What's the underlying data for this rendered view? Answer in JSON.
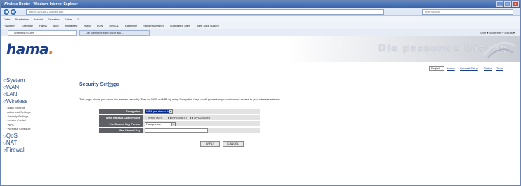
{
  "window": {
    "title": "Wireless Router - Windows Internet Explorer",
    "controls": [
      "_",
      "□",
      "x"
    ]
  },
  "address": {
    "url": "http://192.168.2.1/index.asp",
    "search_placeholder": "Live Search"
  },
  "menubar": {
    "items": [
      "Datei",
      "Bearbeiten",
      "Ansicht",
      "Favoriten",
      "Extras",
      "?"
    ]
  },
  "favorites": {
    "items": [
      "Favoriten",
      "EasyNav",
      "Hama",
      "Audi",
      "Raiffeisen",
      "Hypo",
      "FON",
      "MySQL",
      "Kategorie",
      "Stellenanzeigen",
      "Suggested Sites",
      "Web Slice Gallery"
    ]
  },
  "tabs": {
    "items": [
      "Wireless Router",
      "Die Webseite kann nicht ang..."
    ],
    "commands": "Seite ▾  Sicherheit ▾  Extras ▾"
  },
  "brand": {
    "logo": "hama",
    "slogan": "Die passende Lösung"
  },
  "toplinks": {
    "language": "English",
    "items": [
      "Home",
      "General Setup",
      "Status",
      "Tools"
    ]
  },
  "sidebar": {
    "main": [
      "System",
      "WAN",
      "LAN",
      "Wireless"
    ],
    "sub": [
      "Basic Settings",
      "Advanced Settings",
      "Security Settings",
      "Access Control",
      "WPS",
      "Wireless Schedule"
    ],
    "after": [
      "QoS",
      "NAT",
      "Firewall"
    ]
  },
  "page": {
    "heading": "Security Settings",
    "description": "This page allows you setup the wireless security. Turn on WEP or WPA by using Encryption Keys could prevent any unauthorized access to your wireless network."
  },
  "form": {
    "encryption_label": "Encryption",
    "encryption_value": "WPA pre-shared key",
    "cipher_label": "WPA Unicast Cipher Suite",
    "cipher_options": [
      "WPA(TKIP)",
      "WPA2(AES)",
      "WPA2 Mixed"
    ],
    "psk_format_label": "Pre-Shared Key Format",
    "psk_format_value": "Passphrase",
    "psk_label": "Pre-Shared Key",
    "psk_value": "",
    "apply": "APPLY",
    "cancel": "CANCEL"
  }
}
